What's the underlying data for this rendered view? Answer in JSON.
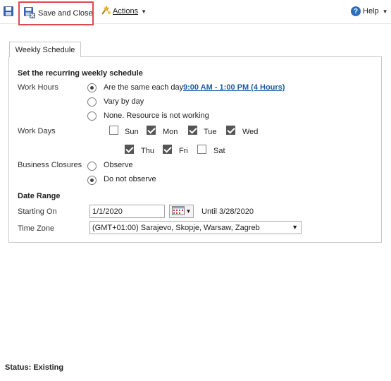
{
  "toolbar": {
    "save_close_label": "Save and Close",
    "actions_label": "Actions",
    "help_label": "Help"
  },
  "tabs": [
    {
      "label": "Weekly Schedule"
    }
  ],
  "schedule": {
    "heading": "Set the recurring weekly schedule",
    "work_hours": {
      "label": "Work Hours",
      "options": [
        {
          "label": "Are the same each day",
          "checked": true
        },
        {
          "label": "Vary by day",
          "checked": false
        },
        {
          "label": "None. Resource is not working",
          "checked": false
        }
      ],
      "hours_link": "9:00 AM - 1:00 PM (4 Hours)"
    },
    "work_days": {
      "label": "Work Days",
      "days": [
        {
          "label": "Sun",
          "checked": false
        },
        {
          "label": "Mon",
          "checked": true
        },
        {
          "label": "Tue",
          "checked": true
        },
        {
          "label": "Wed",
          "checked": true
        },
        {
          "label": "Thu",
          "checked": true
        },
        {
          "label": "Fri",
          "checked": true
        },
        {
          "label": "Sat",
          "checked": false
        }
      ]
    },
    "business_closures": {
      "label": "Business Closures",
      "options": [
        {
          "label": "Observe",
          "checked": false
        },
        {
          "label": "Do not observe",
          "checked": true
        }
      ]
    }
  },
  "date_range": {
    "heading": "Date Range",
    "starting_on_label": "Starting On",
    "starting_on_value": "1/1/2020",
    "until_text": "Until 3/28/2020",
    "time_zone_label": "Time Zone",
    "time_zone_value": "(GMT+01:00) Sarajevo, Skopje, Warsaw, Zagreb"
  },
  "status": {
    "text": "Status: Existing"
  },
  "colors": {
    "highlight_border": "#e0484f",
    "link": "#1a5da8",
    "help_icon": "#2a6fbd"
  },
  "icons": {
    "save": "save-icon",
    "save_close": "save-close-icon",
    "actions": "actions-icon",
    "help": "help-icon",
    "calendar": "calendar-icon"
  }
}
